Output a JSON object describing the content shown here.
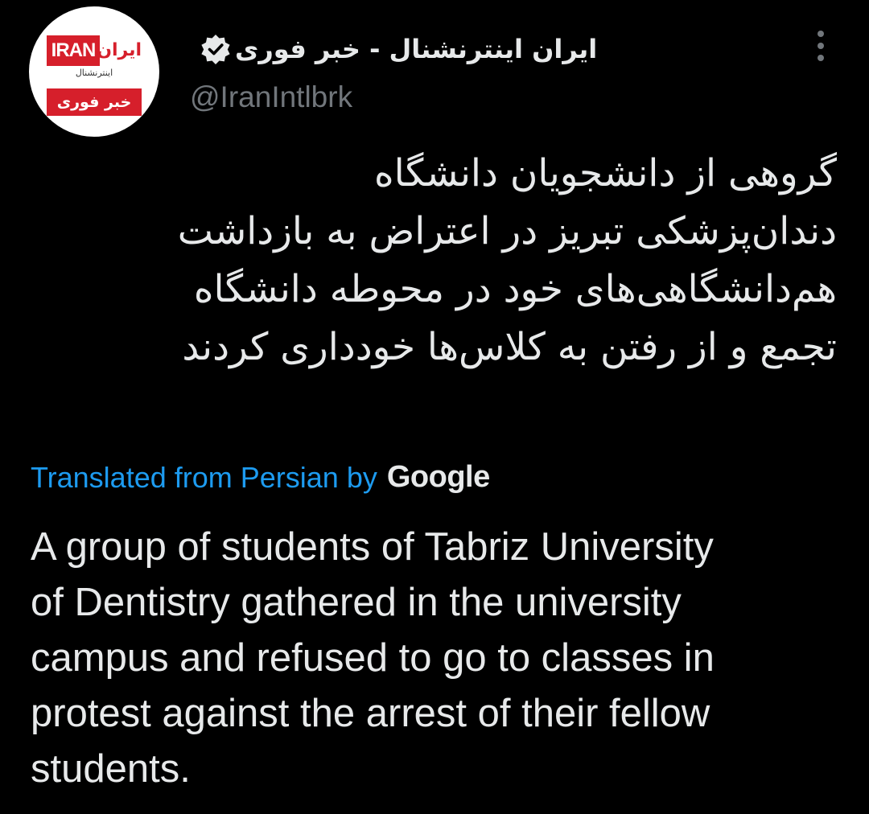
{
  "tweet": {
    "avatar": {
      "logo_en": "IRAN",
      "logo_fa": "ایران",
      "logo_sub": "اینترنشنال",
      "logo_break": "خبر فوری"
    },
    "display_name": "ایران اینترنشنال - خبر فوری",
    "verified": true,
    "handle": "@IranIntlbrk",
    "more_icon": "more-options-icon",
    "text_fa_lines": [
      "گروهی از دانشجویان دانشگاه",
      "دندان‌پزشکی تبریز در اعتراض به بازداشت",
      "هم‌دانشگاهی‌های خود در محوطه دانشگاه",
      "تجمع و از رفتن به کلاس‌ها خودداری کردند"
    ],
    "translation": {
      "label": "Translated from Persian by",
      "provider": "Google"
    },
    "text_en_lines": [
      "A group of students of Tabriz University",
      "of Dentistry gathered in the university",
      "campus and refused to go to classes in",
      "protest against the arrest of their fellow",
      "students."
    ]
  },
  "colors": {
    "background": "#000000",
    "text": "#e7e9ea",
    "secondary": "#71767b",
    "link": "#1d9bf0",
    "brand_red": "#d61f2b"
  }
}
